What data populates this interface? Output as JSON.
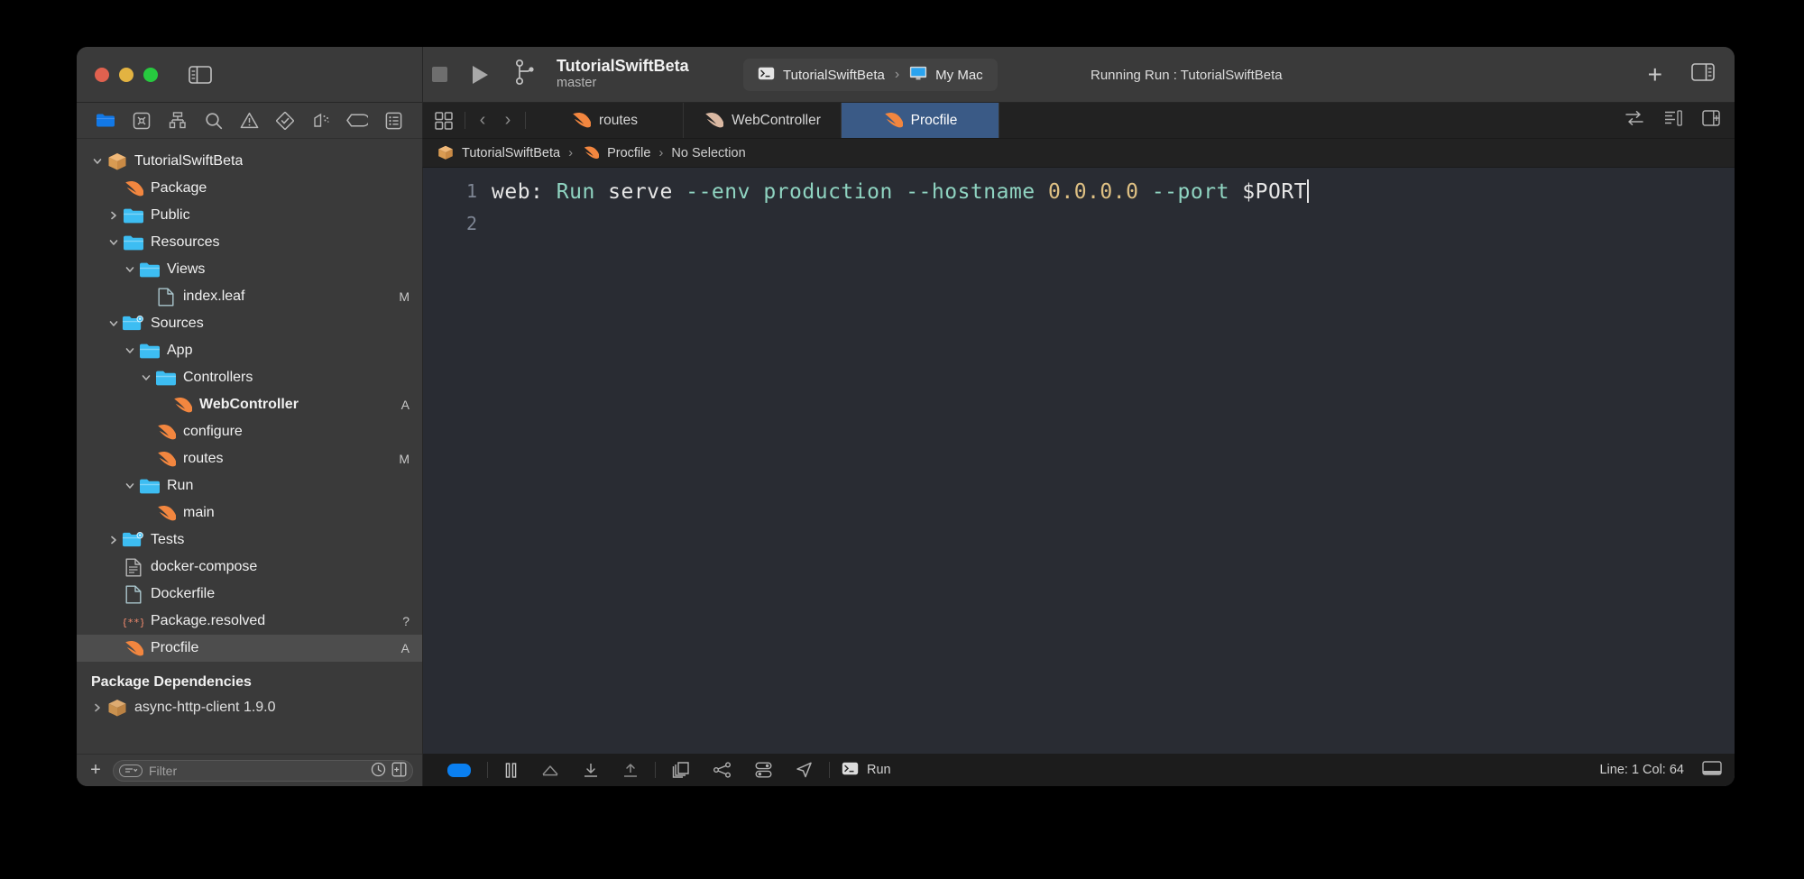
{
  "window": {
    "traffic_lights": [
      "close",
      "minimize",
      "zoom"
    ]
  },
  "toolbar": {
    "scheme_title": "TutorialSwiftBeta",
    "branch": "master",
    "destination_scheme": "TutorialSwiftBeta",
    "destination_device": "My Mac",
    "destination_separator": "›",
    "status": "Running Run : TutorialSwiftBeta",
    "add_label": "+",
    "stop_icon": "stop-icon",
    "run_icon": "play-icon",
    "branch_icon": "source-control-branch-icon",
    "terminal_icon": "terminal-icon",
    "mac_icon": "imac-icon"
  },
  "navigator": {
    "icons": [
      "folder-icon",
      "source-control-icon",
      "symbol-hierarchy-icon",
      "find-icon",
      "issue-warning-icon",
      "test-diamond-icon",
      "debug-icon",
      "breakpoint-tag-icon",
      "report-list-icon"
    ],
    "tree": [
      {
        "label": "TutorialSwiftBeta",
        "icon": "package-icon",
        "indent": 0,
        "twisty": "down",
        "badge": "",
        "bold": false,
        "selected": false
      },
      {
        "label": "Package",
        "icon": "swift-icon",
        "indent": 1,
        "twisty": "",
        "badge": "",
        "bold": false,
        "selected": false
      },
      {
        "label": "Public",
        "icon": "folder-icon",
        "indent": 1,
        "twisty": "right",
        "badge": "",
        "bold": false,
        "selected": false
      },
      {
        "label": "Resources",
        "icon": "folder-icon",
        "indent": 1,
        "twisty": "down",
        "badge": "",
        "bold": false,
        "selected": false
      },
      {
        "label": "Views",
        "icon": "folder-icon",
        "indent": 2,
        "twisty": "down",
        "badge": "",
        "bold": false,
        "selected": false
      },
      {
        "label": "index.leaf",
        "icon": "file-icon",
        "indent": 3,
        "twisty": "",
        "badge": "M",
        "bold": false,
        "selected": false
      },
      {
        "label": "Sources",
        "icon": "folder-gear-icon",
        "indent": 1,
        "twisty": "down",
        "badge": "",
        "bold": false,
        "selected": false
      },
      {
        "label": "App",
        "icon": "folder-icon",
        "indent": 2,
        "twisty": "down",
        "badge": "",
        "bold": false,
        "selected": false
      },
      {
        "label": "Controllers",
        "icon": "folder-icon",
        "indent": 3,
        "twisty": "down",
        "badge": "",
        "bold": false,
        "selected": false
      },
      {
        "label": "WebController",
        "icon": "swift-icon",
        "indent": 4,
        "twisty": "",
        "badge": "A",
        "bold": true,
        "selected": false
      },
      {
        "label": "configure",
        "icon": "swift-icon",
        "indent": 3,
        "twisty": "",
        "badge": "",
        "bold": false,
        "selected": false
      },
      {
        "label": "routes",
        "icon": "swift-icon",
        "indent": 3,
        "twisty": "",
        "badge": "M",
        "bold": false,
        "selected": false
      },
      {
        "label": "Run",
        "icon": "folder-icon",
        "indent": 2,
        "twisty": "down",
        "badge": "",
        "bold": false,
        "selected": false
      },
      {
        "label": "main",
        "icon": "swift-icon",
        "indent": 3,
        "twisty": "",
        "badge": "",
        "bold": false,
        "selected": false
      },
      {
        "label": "Tests",
        "icon": "folder-gear-icon",
        "indent": 1,
        "twisty": "right",
        "badge": "",
        "bold": false,
        "selected": false
      },
      {
        "label": "docker-compose",
        "icon": "text-doc-icon",
        "indent": 1,
        "twisty": "",
        "badge": "",
        "bold": false,
        "selected": false
      },
      {
        "label": "Dockerfile",
        "icon": "file-icon",
        "indent": 1,
        "twisty": "",
        "badge": "",
        "bold": false,
        "selected": false
      },
      {
        "label": "Package.resolved",
        "icon": "json-icon",
        "indent": 1,
        "twisty": "",
        "badge": "?",
        "bold": false,
        "selected": false
      },
      {
        "label": "Procfile",
        "icon": "swift-icon",
        "indent": 1,
        "twisty": "",
        "badge": "A",
        "bold": false,
        "selected": true
      }
    ],
    "section_header": "Package Dependencies",
    "dependency_partial": "async-http-client 1.9.0",
    "filter": {
      "placeholder": "Filter",
      "value": "",
      "recent_icon": "clock-icon",
      "scope_icon": "filter-scope-icon"
    }
  },
  "editor": {
    "tabs": [
      {
        "label": "routes",
        "icon": "swift-icon",
        "active": false
      },
      {
        "label": "WebController",
        "icon": "swift-icon",
        "active": false
      },
      {
        "label": "Procfile",
        "icon": "swift-icon",
        "active": true
      }
    ],
    "breadcrumb": [
      {
        "label": "TutorialSwiftBeta",
        "icon": "package-icon"
      },
      {
        "label": "Procfile",
        "icon": "swift-icon"
      },
      {
        "label": "No Selection",
        "icon": ""
      }
    ],
    "breadcrumb_separator": "›",
    "lines": [
      {
        "number": "1",
        "tokens": [
          {
            "text": "web: ",
            "color": "#e6e6e6"
          },
          {
            "text": "Run",
            "color": "#8fd4c1"
          },
          {
            "text": " serve ",
            "color": "#e6e6e6"
          },
          {
            "text": "--env",
            "color": "#8fd4c1"
          },
          {
            "text": " ",
            "color": "#e6e6e6"
          },
          {
            "text": "production",
            "color": "#8fd4c1"
          },
          {
            "text": " ",
            "color": "#e6e6e6"
          },
          {
            "text": "--hostname",
            "color": "#8fd4c1"
          },
          {
            "text": " ",
            "color": "#e6e6e6"
          },
          {
            "text": "0.0.0.0",
            "color": "#dfc184"
          },
          {
            "text": " ",
            "color": "#e6e6e6"
          },
          {
            "text": "--port",
            "color": "#8fd4c1"
          },
          {
            "text": " ",
            "color": "#e6e6e6"
          },
          {
            "text": "$PORT",
            "color": "#e6e6e6"
          }
        ],
        "has_cursor": true
      },
      {
        "number": "2",
        "tokens": [],
        "has_cursor": false
      }
    ]
  },
  "statusbar": {
    "run_label": "Run",
    "line_col": "Line: 1  Col: 64",
    "icons": [
      "activity-pill-icon",
      "pause-icon",
      "step-over-icon",
      "step-into-icon",
      "step-out-icon",
      "view-debug-hierarchy-icon",
      "memory-graph-icon",
      "environment-overrides-icon",
      "location-simulate-icon"
    ]
  },
  "colors": {
    "accent_blue": "#0a7ff0",
    "tab_active_blue": "#3a5a86",
    "swift_orange": "#f2863f",
    "folder_blue": "#3dbdf2",
    "editor_bg": "#292c33",
    "sidebar_bg": "#3a3a3a",
    "toolbar_bg": "#3a3a3a",
    "string_teal": "#8fd4c1",
    "number_gold": "#dfc184"
  }
}
